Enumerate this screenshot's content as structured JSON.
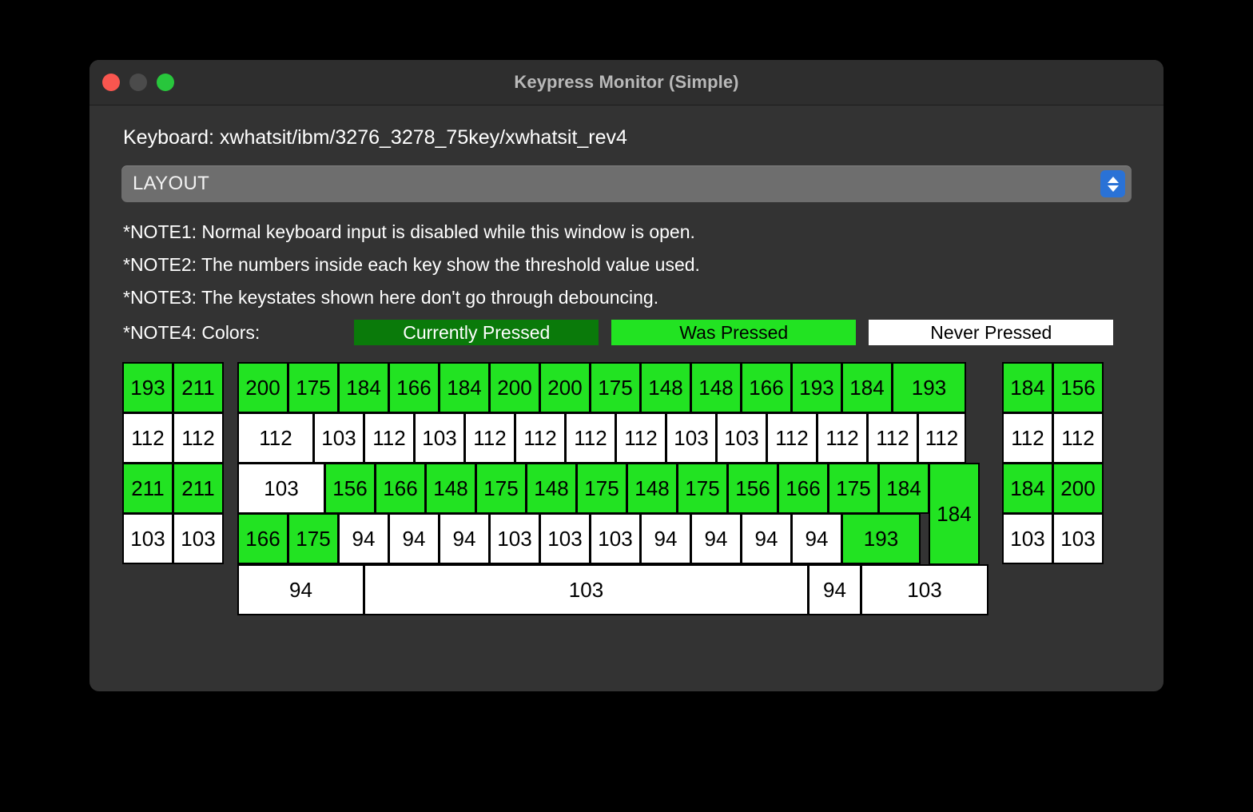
{
  "window": {
    "title": "Keypress Monitor (Simple)",
    "traffic_lights": [
      {
        "name": "close",
        "color": "#f9564f"
      },
      {
        "name": "minimize",
        "color": "#4b4b4b"
      },
      {
        "name": "zoom",
        "color": "#28c63c"
      }
    ]
  },
  "keyboard_label": "Keyboard: xwhatsit/ibm/3276_3278_75key/xwhatsit_rev4",
  "layout_select": {
    "value": "LAYOUT",
    "placeholder": "LAYOUT"
  },
  "notes": [
    "*NOTE1: Normal keyboard input is disabled while this window is open.",
    "*NOTE2: The numbers inside each key show the threshold value used.",
    "*NOTE3: The keystates shown here don't go through debouncing."
  ],
  "note4": {
    "label": "*NOTE4: Colors:",
    "swatches": [
      {
        "label": "Currently Pressed",
        "state": "current",
        "bg": "#0a7a0a",
        "fg": "#ffffff"
      },
      {
        "label": "Was Pressed",
        "state": "was",
        "bg": "#22e322",
        "fg": "#000000"
      },
      {
        "label": "Never Pressed",
        "state": "never",
        "bg": "#ffffff",
        "fg": "#000000"
      }
    ]
  },
  "legend_states": {
    "current": "Currently Pressed",
    "was": "Was Pressed",
    "never": "Never Pressed"
  },
  "keyboard_layout": {
    "left_block": {
      "rows": [
        [
          {
            "v": "193",
            "s": "was"
          },
          {
            "v": "211",
            "s": "was"
          }
        ],
        [
          {
            "v": "112",
            "s": "never"
          },
          {
            "v": "112",
            "s": "never"
          }
        ],
        [
          {
            "v": "211",
            "s": "was"
          },
          {
            "v": "211",
            "s": "was"
          }
        ],
        [
          {
            "v": "103",
            "s": "never"
          },
          {
            "v": "103",
            "s": "never"
          }
        ]
      ]
    },
    "main_block": {
      "rows": [
        [
          {
            "v": "200",
            "s": "was",
            "w": 1
          },
          {
            "v": "175",
            "s": "was",
            "w": 1
          },
          {
            "v": "184",
            "s": "was",
            "w": 1
          },
          {
            "v": "166",
            "s": "was",
            "w": 1
          },
          {
            "v": "184",
            "s": "was",
            "w": 1
          },
          {
            "v": "200",
            "s": "was",
            "w": 1
          },
          {
            "v": "200",
            "s": "was",
            "w": 1
          },
          {
            "v": "175",
            "s": "was",
            "w": 1
          },
          {
            "v": "148",
            "s": "was",
            "w": 1
          },
          {
            "v": "148",
            "s": "was",
            "w": 1
          },
          {
            "v": "166",
            "s": "was",
            "w": 1
          },
          {
            "v": "193",
            "s": "was",
            "w": 1
          },
          {
            "v": "184",
            "s": "was",
            "w": 1
          },
          {
            "v": "193",
            "s": "was",
            "w": 1.45
          }
        ],
        [
          {
            "v": "112",
            "s": "never",
            "w": 1.5
          },
          {
            "v": "103",
            "s": "never",
            "w": 1
          },
          {
            "v": "112",
            "s": "never",
            "w": 1
          },
          {
            "v": "103",
            "s": "never",
            "w": 1
          },
          {
            "v": "112",
            "s": "never",
            "w": 1
          },
          {
            "v": "112",
            "s": "never",
            "w": 1
          },
          {
            "v": "112",
            "s": "never",
            "w": 1
          },
          {
            "v": "112",
            "s": "never",
            "w": 1
          },
          {
            "v": "103",
            "s": "never",
            "w": 1
          },
          {
            "v": "103",
            "s": "never",
            "w": 1
          },
          {
            "v": "112",
            "s": "never",
            "w": 1
          },
          {
            "v": "112",
            "s": "never",
            "w": 1
          },
          {
            "v": "112",
            "s": "never",
            "w": 1
          },
          {
            "v": "112",
            "s": "never",
            "w": 0.95
          }
        ],
        [
          {
            "v": "103",
            "s": "never",
            "w": 1.72
          },
          {
            "v": "156",
            "s": "was",
            "w": 1
          },
          {
            "v": "166",
            "s": "was",
            "w": 1
          },
          {
            "v": "148",
            "s": "was",
            "w": 1
          },
          {
            "v": "175",
            "s": "was",
            "w": 1
          },
          {
            "v": "148",
            "s": "was",
            "w": 1
          },
          {
            "v": "175",
            "s": "was",
            "w": 1
          },
          {
            "v": "148",
            "s": "was",
            "w": 1
          },
          {
            "v": "175",
            "s": "was",
            "w": 1
          },
          {
            "v": "156",
            "s": "was",
            "w": 1
          },
          {
            "v": "166",
            "s": "was",
            "w": 1
          },
          {
            "v": "175",
            "s": "was",
            "w": 1
          },
          {
            "v": "184",
            "s": "was",
            "w": 1
          }
        ],
        [
          {
            "v": "166",
            "s": "was",
            "w": 1
          },
          {
            "v": "175",
            "s": "was",
            "w": 1
          },
          {
            "v": "94",
            "s": "never",
            "w": 1
          },
          {
            "v": "94",
            "s": "never",
            "w": 1
          },
          {
            "v": "94",
            "s": "never",
            "w": 1
          },
          {
            "v": "103",
            "s": "never",
            "w": 1
          },
          {
            "v": "103",
            "s": "never",
            "w": 1
          },
          {
            "v": "103",
            "s": "never",
            "w": 1
          },
          {
            "v": "94",
            "s": "never",
            "w": 1
          },
          {
            "v": "94",
            "s": "never",
            "w": 1
          },
          {
            "v": "94",
            "s": "never",
            "w": 1
          },
          {
            "v": "94",
            "s": "never",
            "w": 1
          },
          {
            "v": "193",
            "s": "was",
            "w": 1.55
          }
        ],
        [
          {
            "v": "94",
            "s": "never",
            "w": 2.48
          },
          {
            "v": "103",
            "s": "never",
            "w": 8.7
          },
          {
            "v": "94",
            "s": "never",
            "w": 1.05
          },
          {
            "v": "103",
            "s": "never",
            "w": 2.5
          }
        ]
      ],
      "enter_key": {
        "v": "184",
        "s": "was"
      }
    },
    "right_block": {
      "rows": [
        [
          {
            "v": "184",
            "s": "was"
          },
          {
            "v": "156",
            "s": "was"
          }
        ],
        [
          {
            "v": "112",
            "s": "never"
          },
          {
            "v": "112",
            "s": "never"
          }
        ],
        [
          {
            "v": "184",
            "s": "was"
          },
          {
            "v": "200",
            "s": "was"
          }
        ],
        [
          {
            "v": "103",
            "s": "never"
          },
          {
            "v": "103",
            "s": "never"
          }
        ]
      ]
    }
  }
}
